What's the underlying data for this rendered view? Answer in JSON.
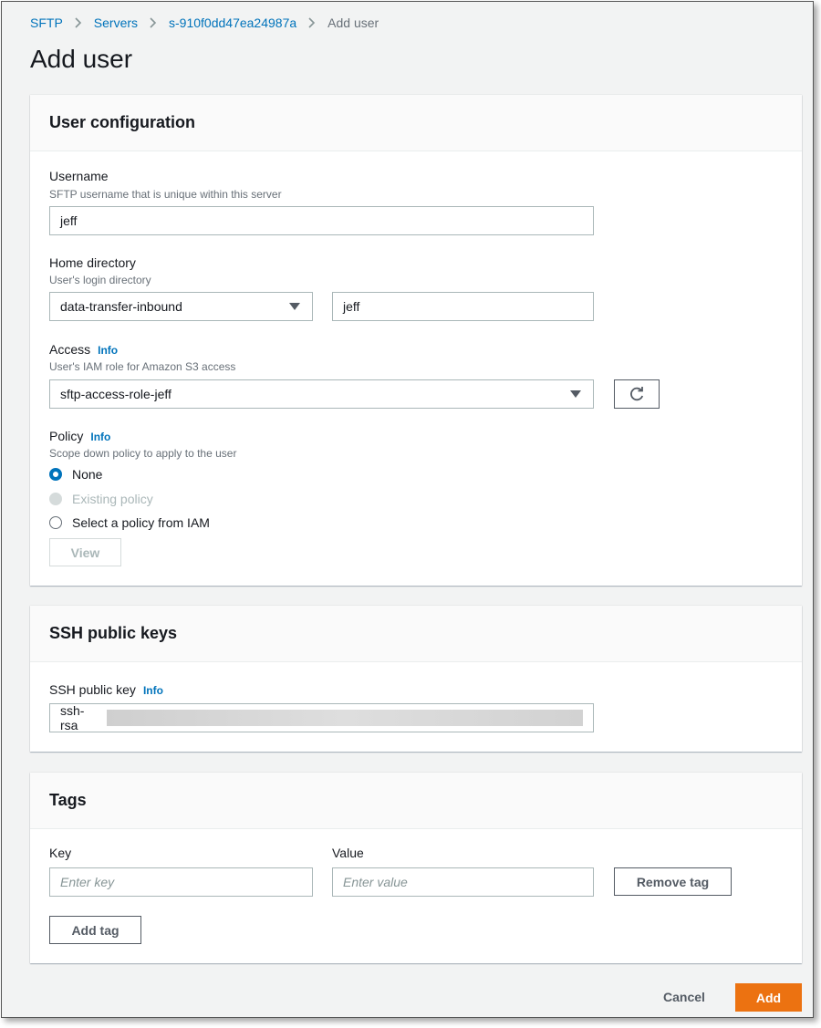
{
  "breadcrumb": {
    "items": [
      "SFTP",
      "Servers",
      "s-910f0dd47ea24987a"
    ],
    "current": "Add user"
  },
  "page_title": "Add user",
  "user_config": {
    "title": "User configuration",
    "username": {
      "label": "Username",
      "description": "SFTP username that is unique within this server",
      "value": "jeff"
    },
    "home_directory": {
      "label": "Home directory",
      "description": "User's login directory",
      "bucket": "data-transfer-inbound",
      "path": "jeff"
    },
    "access": {
      "label": "Access",
      "info": "Info",
      "description": "User's IAM role for Amazon S3 access",
      "role": "sftp-access-role-jeff"
    },
    "policy": {
      "label": "Policy",
      "info": "Info",
      "description": "Scope down policy to apply to the user",
      "options": [
        "None",
        "Existing policy",
        "Select a policy from IAM"
      ],
      "selected": "None",
      "view_label": "View"
    }
  },
  "ssh_keys": {
    "title": "SSH public keys",
    "label": "SSH public key",
    "info": "Info",
    "value_prefix": "ssh-rsa"
  },
  "tags": {
    "title": "Tags",
    "key_label": "Key",
    "value_label": "Value",
    "key_placeholder": "Enter key",
    "value_placeholder": "Enter value",
    "remove_label": "Remove tag",
    "add_label": "Add tag"
  },
  "footer": {
    "cancel_label": "Cancel",
    "add_label": "Add"
  },
  "colors": {
    "link": "#0073bb",
    "primary": "#ec7211",
    "background": "#f2f3f3"
  }
}
